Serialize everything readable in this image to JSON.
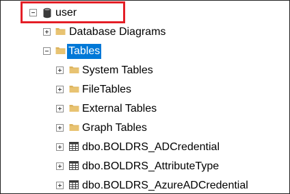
{
  "tree": {
    "root": {
      "label": "user",
      "icon": "database-icon",
      "expander": "collapse"
    },
    "children": [
      {
        "label": "Database Diagrams",
        "icon": "folder-icon",
        "expander": "expand"
      },
      {
        "label": "Tables",
        "icon": "folder-icon",
        "expander": "collapse",
        "selected": true
      },
      {
        "label": "System Tables",
        "icon": "folder-icon",
        "expander": "expand"
      },
      {
        "label": "FileTables",
        "icon": "folder-icon",
        "expander": "expand"
      },
      {
        "label": "External Tables",
        "icon": "folder-icon",
        "expander": "expand"
      },
      {
        "label": "Graph Tables",
        "icon": "folder-icon",
        "expander": "expand"
      },
      {
        "label": "dbo.BOLDRS_ADCredential",
        "icon": "table-icon",
        "expander": "expand"
      },
      {
        "label": "dbo.BOLDRS_AttributeType",
        "icon": "table-icon",
        "expander": "expand"
      },
      {
        "label": "dbo.BOLDRS_AzureADCredential",
        "icon": "table-icon",
        "expander": "expand"
      }
    ]
  },
  "colors": {
    "selection": "#0078d7",
    "highlight_border": "#e41e26",
    "folder": "#dcb35c"
  }
}
